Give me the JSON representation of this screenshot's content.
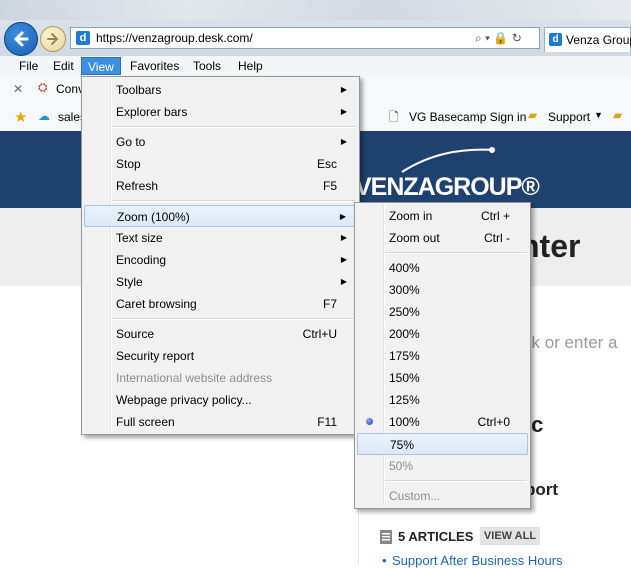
{
  "browser": {
    "url": "https://venzagroup.desk.com/",
    "tab_title": "Venza Group",
    "site_icon": "d"
  },
  "menubar": [
    "File",
    "Edit",
    "View",
    "Favorites",
    "Tools",
    "Help"
  ],
  "command_bar": {
    "item": "Conv"
  },
  "favorites_bar": {
    "item1": "sales",
    "item2": "VG Basecamp Sign in",
    "item3": "Support"
  },
  "view_menu": {
    "toolbars": "Toolbars",
    "explorer_bars": "Explorer bars",
    "go_to": "Go to",
    "stop": "Stop",
    "stop_sc": "Esc",
    "refresh": "Refresh",
    "refresh_sc": "F5",
    "zoom": "Zoom (100%)",
    "text_size": "Text size",
    "encoding": "Encoding",
    "style": "Style",
    "caret": "Caret browsing",
    "caret_sc": "F7",
    "source": "Source",
    "source_sc": "Ctrl+U",
    "security": "Security report",
    "intl": "International website address",
    "privacy": "Webpage privacy policy...",
    "fullscreen": "Full screen",
    "fullscreen_sc": "F11"
  },
  "zoom_menu": {
    "zoom_in": "Zoom in",
    "zoom_in_sc": "Ctrl +",
    "zoom_out": "Zoom out",
    "zoom_out_sc": "Ctrl -",
    "z400": "400%",
    "z300": "300%",
    "z250": "250%",
    "z200": "200%",
    "z175": "175%",
    "z150": "150%",
    "z125": "125%",
    "z100": "100%",
    "z100_sc": "Ctrl+0",
    "z75": "75%",
    "z50": "50%",
    "custom": "Custom..."
  },
  "page": {
    "logo": "VENZAGROUP®",
    "heading": "nter",
    "search_placeholder": "sk or enter a",
    "topic_1": "ic",
    "topic_2": "port",
    "articles": "5 ARTICLES",
    "view_all": "VIEW ALL",
    "article_link": "Support After Business Hours"
  }
}
